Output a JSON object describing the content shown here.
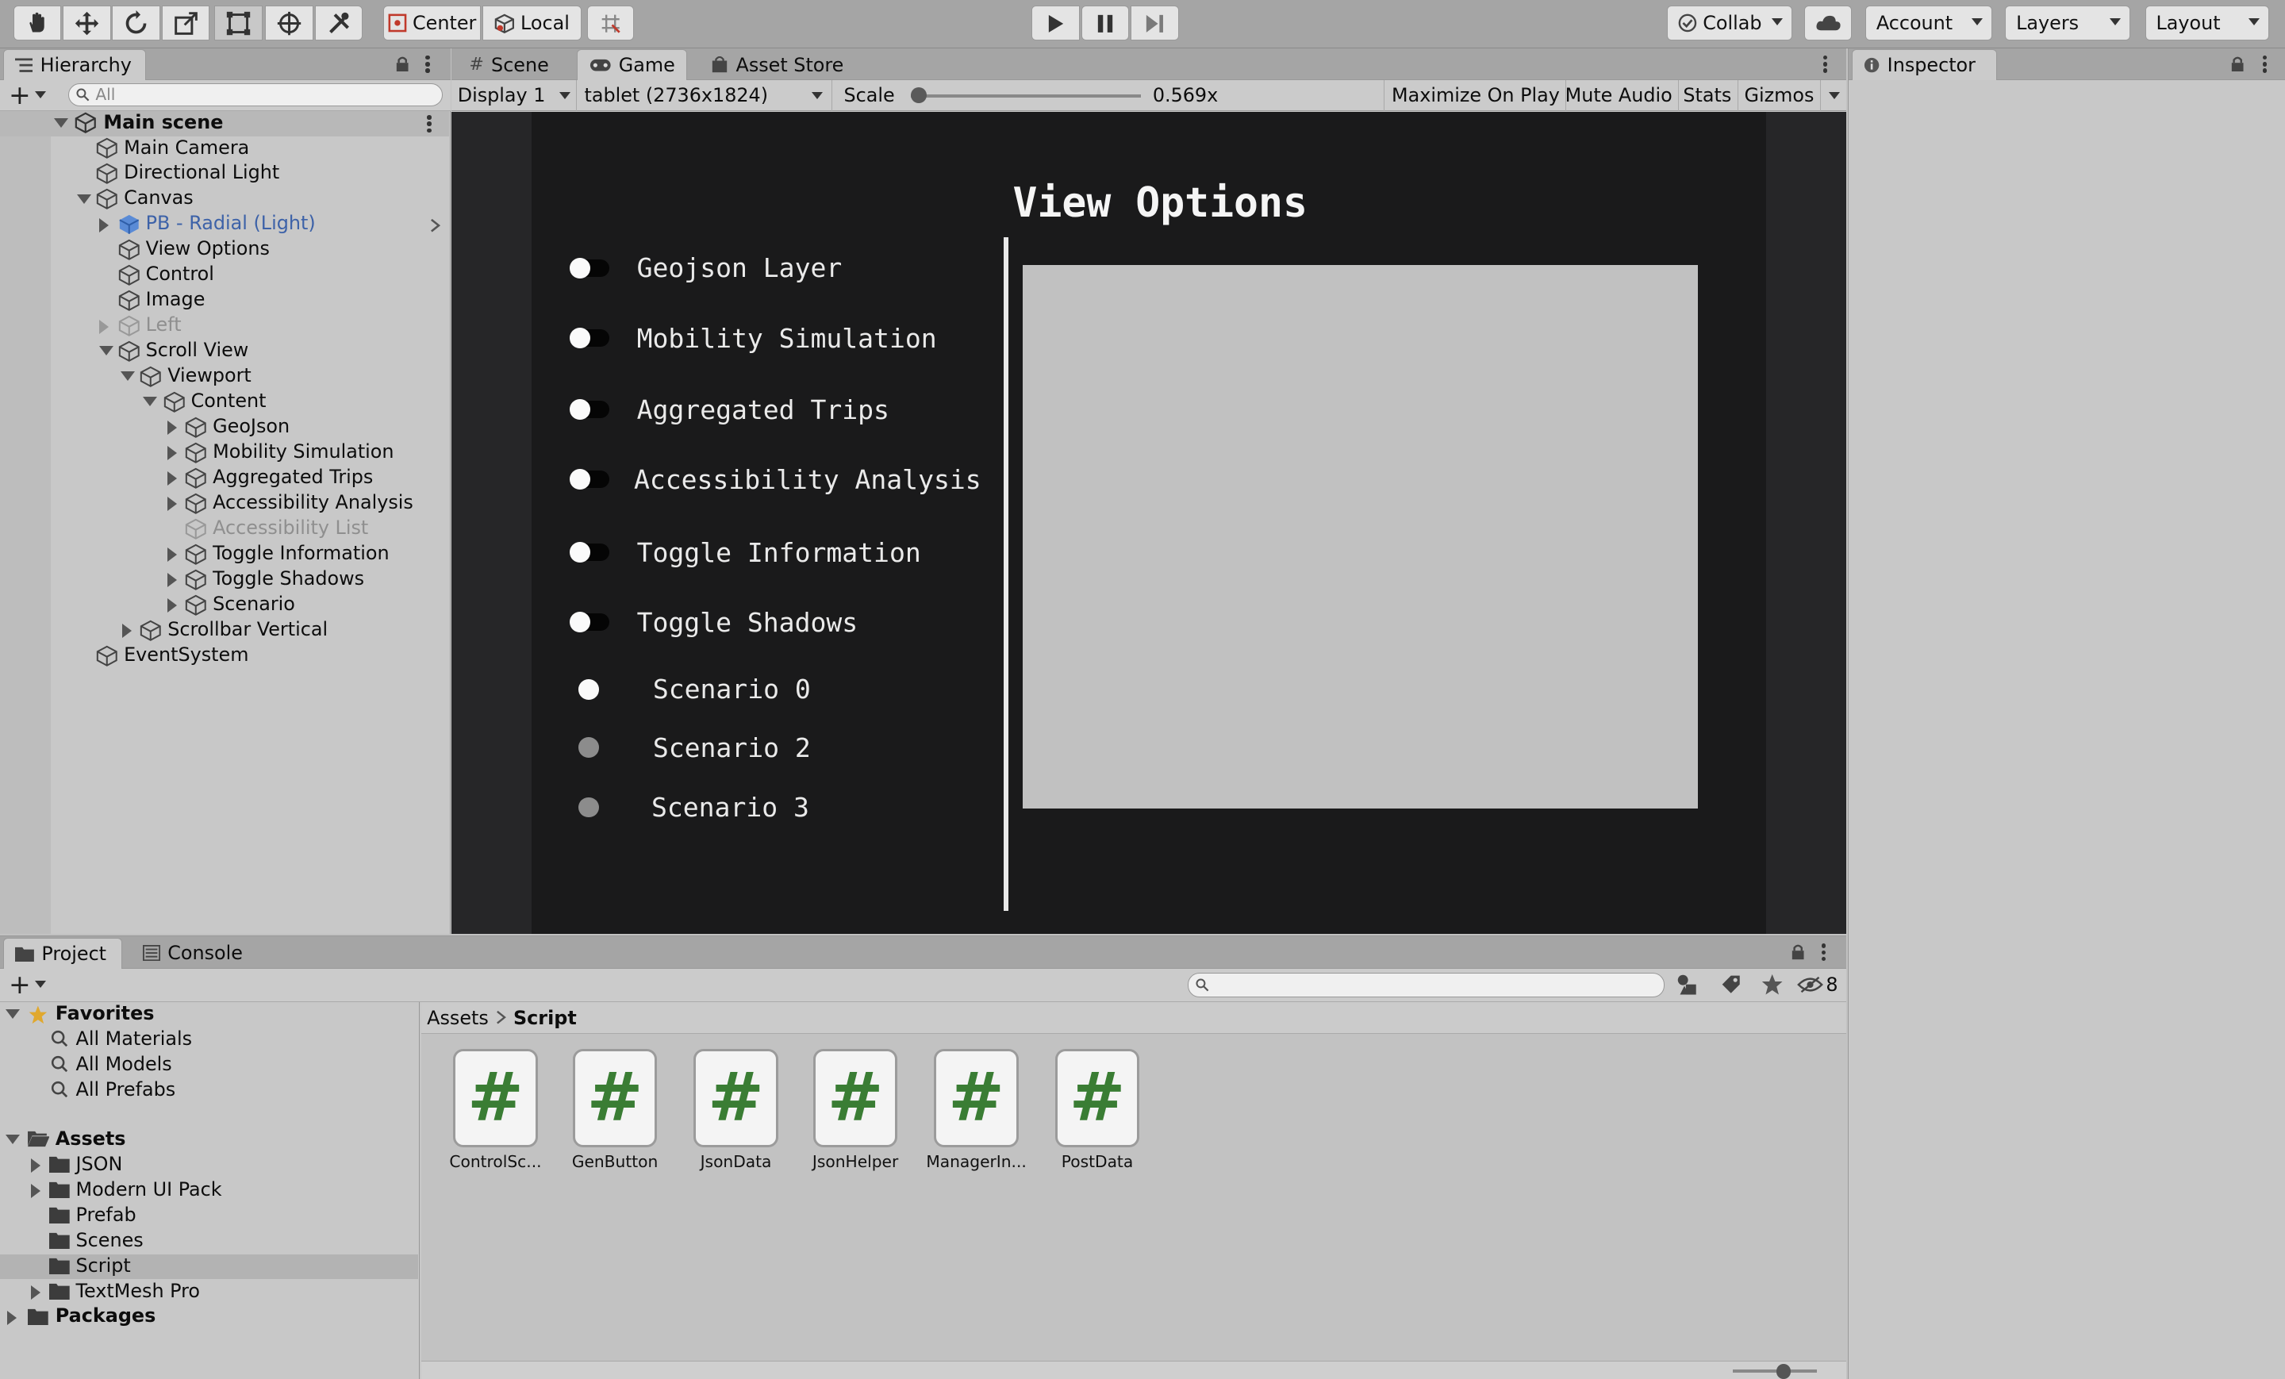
{
  "toolbar": {
    "pivot_label": "Center",
    "space_label": "Local",
    "collab_label": "Collab",
    "account_label": "Account",
    "layers_label": "Layers",
    "layout_label": "Layout"
  },
  "hierarchy": {
    "tab_label": "Hierarchy",
    "search_placeholder": "All",
    "scene_name": "Main scene",
    "items": [
      {
        "label": "Main Camera",
        "state": "normal"
      },
      {
        "label": "Directional Light",
        "state": "normal"
      },
      {
        "label": "Canvas",
        "state": "normal"
      },
      {
        "label": "PB - Radial (Light)",
        "state": "prefab"
      },
      {
        "label": "View Options",
        "state": "normal"
      },
      {
        "label": "Control",
        "state": "normal"
      },
      {
        "label": "Image",
        "state": "normal"
      },
      {
        "label": "Left",
        "state": "disabled"
      },
      {
        "label": "Scroll View",
        "state": "normal"
      },
      {
        "label": "Viewport",
        "state": "normal"
      },
      {
        "label": "Content",
        "state": "normal"
      },
      {
        "label": "GeoJson",
        "state": "normal"
      },
      {
        "label": "Mobility Simulation",
        "state": "normal"
      },
      {
        "label": "Aggregated Trips",
        "state": "normal"
      },
      {
        "label": "Accessibility Analysis",
        "state": "normal"
      },
      {
        "label": "Accessibility List",
        "state": "disabled"
      },
      {
        "label": "Toggle Information",
        "state": "normal"
      },
      {
        "label": "Toggle Shadows",
        "state": "normal"
      },
      {
        "label": "Scenario",
        "state": "normal"
      },
      {
        "label": "Scrollbar Vertical",
        "state": "normal"
      },
      {
        "label": "EventSystem",
        "state": "normal"
      }
    ]
  },
  "center_tabs": {
    "scene": "Scene",
    "game": "Game",
    "asset_store": "Asset Store"
  },
  "game_bar": {
    "display": "Display 1",
    "resolution": "tablet (2736x1824)",
    "scale_label": "Scale",
    "scale_value": "0.569x",
    "scale_fraction": 0.0,
    "maximize": "Maximize On Play",
    "mute": "Mute Audio",
    "stats": "Stats",
    "gizmos": "Gizmos"
  },
  "game_view": {
    "title": "View Options",
    "toggles": [
      {
        "label": "Geojson Layer",
        "on": true
      },
      {
        "label": "Mobility Simulation",
        "on": true
      },
      {
        "label": "Aggregated Trips",
        "on": true
      },
      {
        "label": "Accessibility Analysis",
        "on": true
      },
      {
        "label": "Toggle Information",
        "on": true
      },
      {
        "label": "Toggle Shadows",
        "on": true
      }
    ],
    "scenarios": [
      {
        "label": "Scenario 0",
        "selected": true
      },
      {
        "label": "Scenario 2",
        "selected": false
      },
      {
        "label": "Scenario 3",
        "selected": false
      }
    ]
  },
  "inspector": {
    "tab_label": "Inspector"
  },
  "project": {
    "tab_project": "Project",
    "tab_console": "Console",
    "hidden_count": "8",
    "tree": {
      "favorites": "Favorites",
      "favorite_items": [
        "All Materials",
        "All Models",
        "All Prefabs"
      ],
      "assets": "Assets",
      "asset_folders": [
        "JSON",
        "Modern UI Pack",
        "Prefab",
        "Scenes",
        "Script",
        "TextMesh Pro"
      ],
      "packages": "Packages"
    },
    "breadcrumb": {
      "root": "Assets",
      "current": "Script"
    },
    "files": [
      "ControlSc...",
      "GenButton",
      "JsonData",
      "JsonHelper",
      "ManagerIn...",
      "PostData"
    ]
  },
  "colors": {
    "game_bg": "#1a1a1b",
    "panel_bg": "#c1c1c1",
    "script_hash": "#3a7d34",
    "prefab_text": "#3d62a8"
  }
}
